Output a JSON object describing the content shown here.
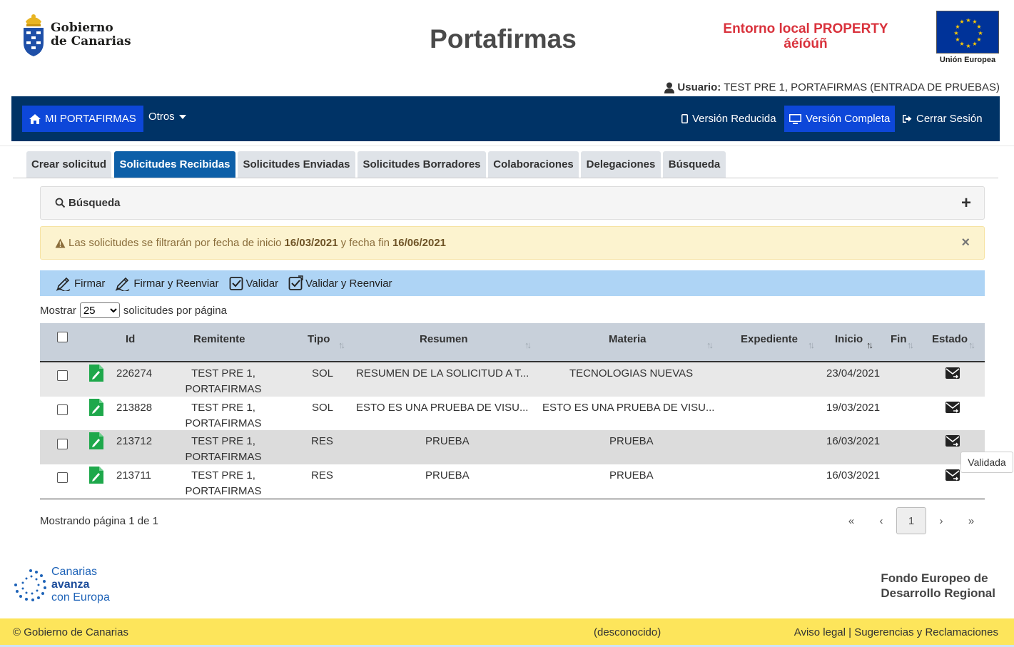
{
  "header": {
    "logo_line1": "Gobierno",
    "logo_line2": "de Canarias",
    "title": "Portafirmas",
    "env_line1": "Entorno local PROPERTY",
    "env_line2": "áéíóúñ",
    "eu_label": "Unión Europea",
    "user_label": "Usuario:",
    "user_value": "TEST PRE 1, PORTAFIRMAS (ENTRADA DE PRUEBAS)"
  },
  "navbar": {
    "home": "MI PORTAFIRMAS",
    "others": "Otros",
    "reduced": "Versión Reducida",
    "full": "Versión Completa",
    "logout": "Cerrar Sesión"
  },
  "tabs": [
    {
      "label": "Crear solicitud"
    },
    {
      "label": "Solicitudes Recibidas"
    },
    {
      "label": "Solicitudes Enviadas"
    },
    {
      "label": "Solicitudes Borradores"
    },
    {
      "label": "Colaboraciones"
    },
    {
      "label": "Delegaciones"
    },
    {
      "label": "Búsqueda"
    }
  ],
  "search_panel": {
    "label": "Búsqueda",
    "toggle": "+"
  },
  "alert": {
    "prefix": "Las solicitudes se filtrarán por fecha de inicio",
    "start": "16/03/2021",
    "middle": "y fecha fin",
    "end": "16/06/2021",
    "close": "×"
  },
  "toolbar": {
    "sign": "Firmar",
    "sign_forward": "Firmar y Reenviar",
    "validate": "Validar",
    "validate_forward": "Validar y Reenviar"
  },
  "page_size": {
    "prefix": "Mostrar",
    "value": "25",
    "suffix": "solicitudes por página"
  },
  "table": {
    "headers": {
      "id": "Id",
      "sender": "Remitente",
      "type": "Tipo",
      "summary": "Resumen",
      "subject": "Materia",
      "file": "Expediente",
      "start": "Inicio",
      "end": "Fin",
      "status": "Estado"
    },
    "rows": [
      {
        "id": "226274",
        "sender1": "TEST PRE 1,",
        "sender2": "PORTAFIRMAS",
        "type": "SOL",
        "summary": "RESUMEN DE LA SOLICITUD A T...",
        "subject": "TECNOLOGIAS NUEVAS",
        "start": "23/04/2021"
      },
      {
        "id": "213828",
        "sender1": "TEST PRE 1,",
        "sender2": "PORTAFIRMAS",
        "type": "SOL",
        "summary": "ESTO ES UNA PRUEBA DE VISU...",
        "subject": "ESTO ES UNA PRUEBA DE VISU...",
        "start": "19/03/2021"
      },
      {
        "id": "213712",
        "sender1": "TEST PRE 1,",
        "sender2": "PORTAFIRMAS",
        "type": "RES",
        "summary": "PRUEBA",
        "subject": "PRUEBA",
        "start": "16/03/2021"
      },
      {
        "id": "213711",
        "sender1": "TEST PRE 1,",
        "sender2": "PORTAFIRMAS",
        "type": "RES",
        "summary": "PRUEBA",
        "subject": "PRUEBA",
        "start": "16/03/2021"
      }
    ],
    "tooltip": "Validada"
  },
  "pagination": {
    "info": "Mostrando página 1 de 1",
    "first": "«",
    "prev": "‹",
    "current": "1",
    "next": "›",
    "last": "»"
  },
  "footer": {
    "cae_line1": "Canarias",
    "cae_line2": "avanza",
    "cae_line3": "con Europa",
    "feder_line1": "Fondo Europeo de",
    "feder_line2": "Desarrollo Regional",
    "copyright": "© Gobierno de Canarias",
    "center": "(desconocido)",
    "links": "Aviso legal | Sugerencias y Reclamaciones"
  },
  "colors": {
    "navbar": "#003366",
    "active": "#0d47d9",
    "tab_active": "#0d5fa8",
    "alert_bg": "#fcf3cf",
    "toolbar_bg": "#aed4f5",
    "footer_bg": "#fde55b"
  },
  "icons": {
    "home": "home-icon",
    "user": "user-icon",
    "mobile": "mobile-icon",
    "desktop": "desktop-icon",
    "logout": "sign-out-icon",
    "search": "search-icon",
    "warning": "warning-icon",
    "sign": "pen-signature-icon",
    "validate": "check-square-icon",
    "edit": "edit-document-icon",
    "status": "envelope-forward-icon"
  }
}
